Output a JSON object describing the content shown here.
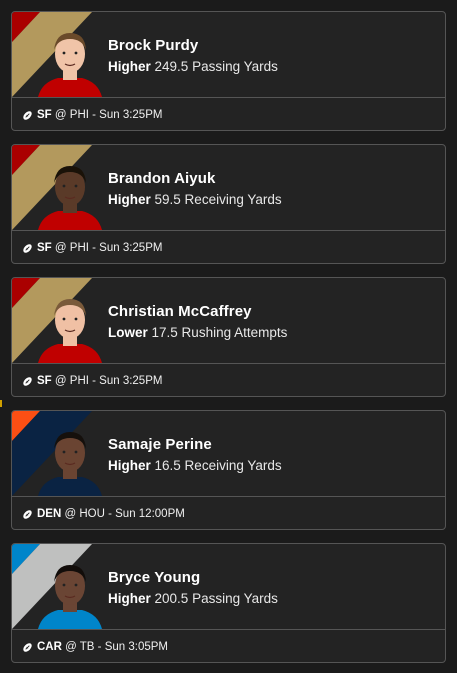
{
  "cards": [
    {
      "player": "Brock Purdy",
      "direction": "Higher",
      "line": "249.5 Passing Yards",
      "team": "SF",
      "matchup": "@ PHI - Sun 3:25PM",
      "stripe_colors": [
        "#aa0000",
        "#b3995d"
      ],
      "jersey_color": "#c00000",
      "skin": "#f0c4a8",
      "hair": "#6a4a2a"
    },
    {
      "player": "Brandon Aiyuk",
      "direction": "Higher",
      "line": "59.5 Receiving Yards",
      "team": "SF",
      "matchup": "@ PHI - Sun 3:25PM",
      "stripe_colors": [
        "#aa0000",
        "#b3995d"
      ],
      "jersey_color": "#c00000",
      "skin": "#5a3a28",
      "hair": "#1a1208"
    },
    {
      "player": "Christian McCaffrey",
      "direction": "Lower",
      "line": "17.5 Rushing Attempts",
      "team": "SF",
      "matchup": "@ PHI - Sun 3:25PM",
      "stripe_colors": [
        "#aa0000",
        "#b3995d"
      ],
      "jersey_color": "#c00000",
      "skin": "#f0c0a4",
      "hair": "#7a5a3a"
    },
    {
      "player": "Samaje Perine",
      "direction": "Higher",
      "line": "16.5 Receiving Yards",
      "team": "DEN",
      "matchup": "@ HOU - Sun 12:00PM",
      "stripe_colors": [
        "#fb4f14",
        "#0a2343"
      ],
      "jersey_color": "#0a2343",
      "skin": "#6a4432",
      "hair": "#15100c"
    },
    {
      "player": "Bryce Young",
      "direction": "Higher",
      "line": "200.5 Passing Yards",
      "team": "CAR",
      "matchup": "@ TB - Sun 3:05PM",
      "stripe_colors": [
        "#0085ca",
        "#bfc0bf"
      ],
      "jersey_color": "#0085ca",
      "skin": "#6a4534",
      "hair": "#120d0a"
    }
  ],
  "icons": {
    "sport": "football-icon"
  }
}
